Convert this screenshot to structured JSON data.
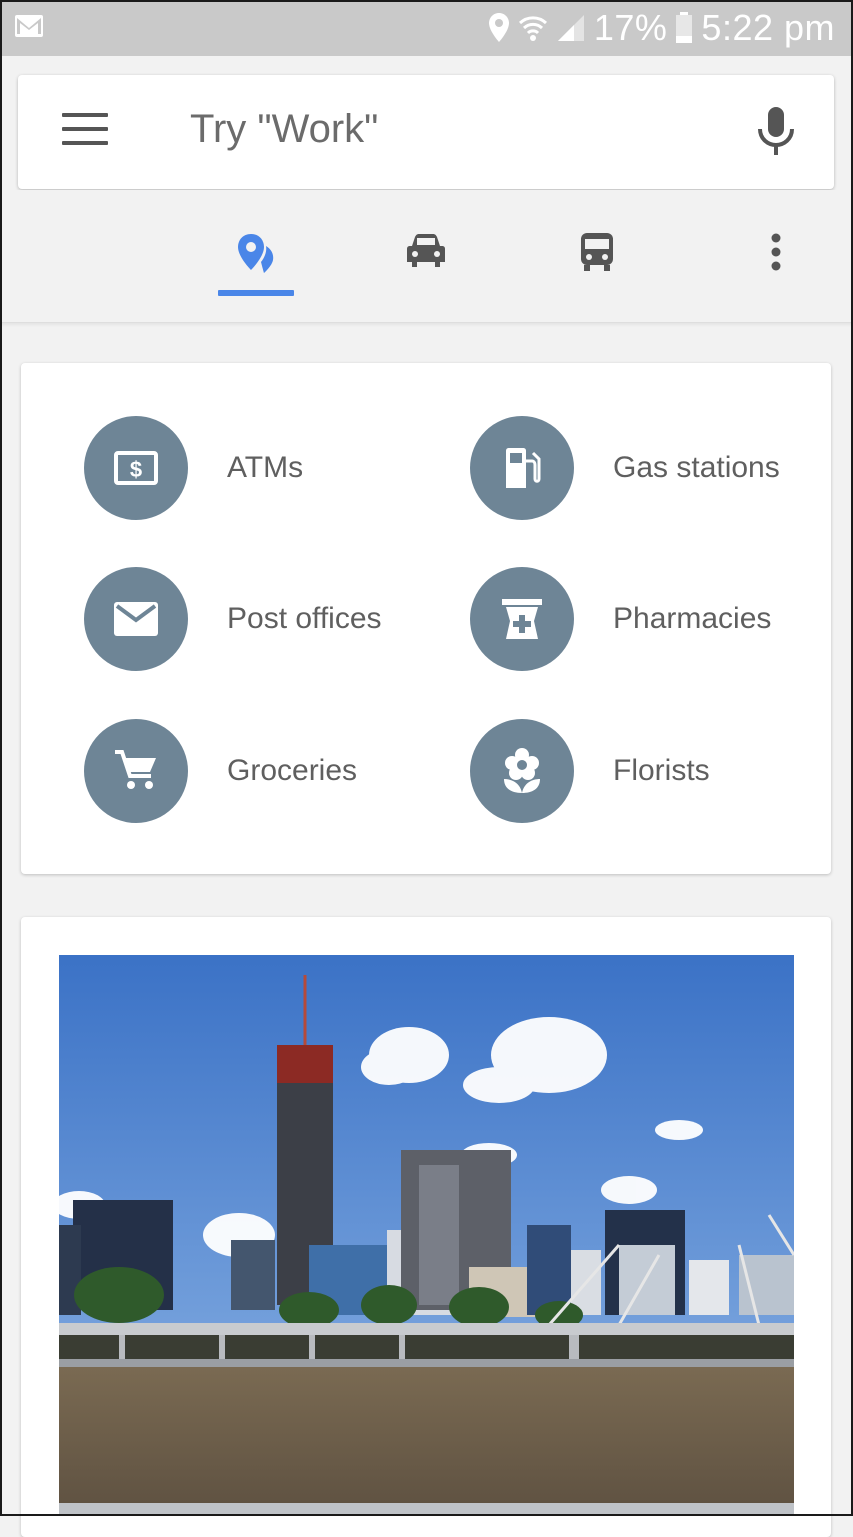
{
  "status_bar": {
    "battery_text": "17%",
    "time_text": "5:22 pm",
    "icons": [
      "gmail-icon",
      "location-icon",
      "wifi-icon",
      "signal-icon",
      "battery-icon"
    ]
  },
  "search": {
    "placeholder": "Try \"Work\"",
    "menu_icon": "hamburger-menu-icon",
    "mic_icon": "microphone-icon"
  },
  "tabs": [
    {
      "name": "explore",
      "icon": "place-icon",
      "selected": true
    },
    {
      "name": "driving",
      "icon": "car-icon",
      "selected": false
    },
    {
      "name": "transit",
      "icon": "bus-icon",
      "selected": false
    },
    {
      "name": "more",
      "icon": "more-vertical-icon",
      "selected": false
    }
  ],
  "categories": [
    {
      "label": "ATMs",
      "icon": "atm-icon"
    },
    {
      "label": "Gas stations",
      "icon": "gas-station-icon"
    },
    {
      "label": "Post offices",
      "icon": "mail-icon"
    },
    {
      "label": "Pharmacies",
      "icon": "pharmacy-icon"
    },
    {
      "label": "Groceries",
      "icon": "cart-icon"
    },
    {
      "label": "Florists",
      "icon": "flower-icon"
    }
  ],
  "colors": {
    "accent": "#4a86e8",
    "category_circle": "#6e8596",
    "status_bar": "#c9c9c9",
    "label_text": "#5f5f5f"
  }
}
